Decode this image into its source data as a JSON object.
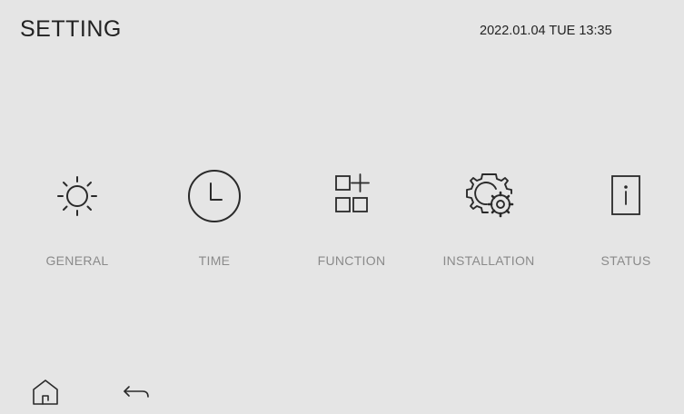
{
  "header": {
    "title": "SETTING",
    "datetime": "2022.01.04 TUE 13:35"
  },
  "menu": {
    "items": [
      {
        "label": "GENERAL",
        "icon": "sun-icon"
      },
      {
        "label": "TIME",
        "icon": "clock-icon"
      },
      {
        "label": "FUNCTION",
        "icon": "grid-plus-icon"
      },
      {
        "label": "INSTALLATION",
        "icon": "gears-icon"
      },
      {
        "label": "STATUS",
        "icon": "info-icon"
      }
    ]
  },
  "footer": {
    "home_icon": "home-icon",
    "back_icon": "back-arrow-icon"
  },
  "colors": {
    "background": "#e5e5e5",
    "text_primary": "#222222",
    "label_gray": "#8a8a8a",
    "icon_stroke": "#2a2a2a"
  }
}
